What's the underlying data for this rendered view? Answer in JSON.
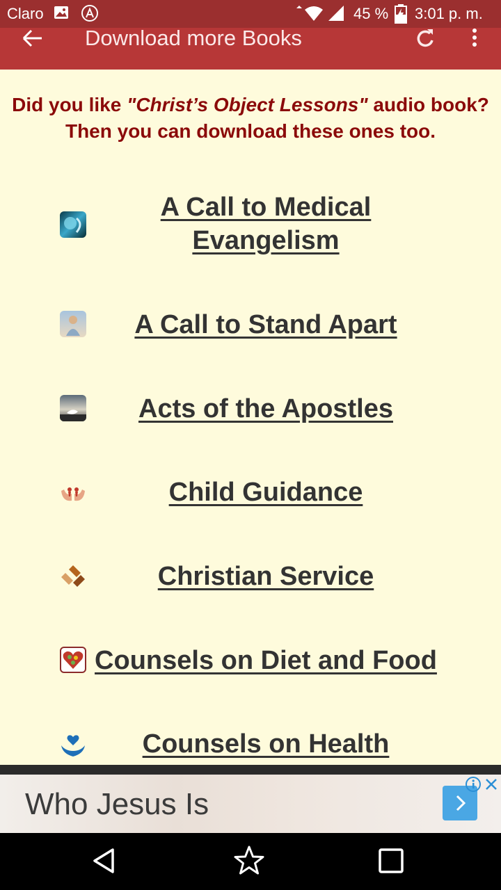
{
  "status_bar": {
    "carrier": "Claro",
    "battery": "45 %",
    "time": "3:01 p. m."
  },
  "app_bar": {
    "title": "Download more Books"
  },
  "intro": {
    "prefix": "Did you like ",
    "book_title": "\"Christ’s Object Lessons\"",
    "suffix": " audio book? Then you can download these ones too."
  },
  "books": [
    {
      "title": "A Call to Medical Evangelism"
    },
    {
      "title": "A Call to Stand Apart"
    },
    {
      "title": "Acts of the Apostles"
    },
    {
      "title": "Child Guidance"
    },
    {
      "title": "Christian Service"
    },
    {
      "title": "Counsels on Diet and Food"
    },
    {
      "title": "Counsels on Health"
    }
  ],
  "ad": {
    "headline": "Who Jesus Is"
  },
  "colors": {
    "status_bar": "#9b2f2f",
    "app_bar": "#b73737",
    "page_background": "#fefbdc",
    "intro_text": "#8b0a0a",
    "link_text": "#333333"
  }
}
